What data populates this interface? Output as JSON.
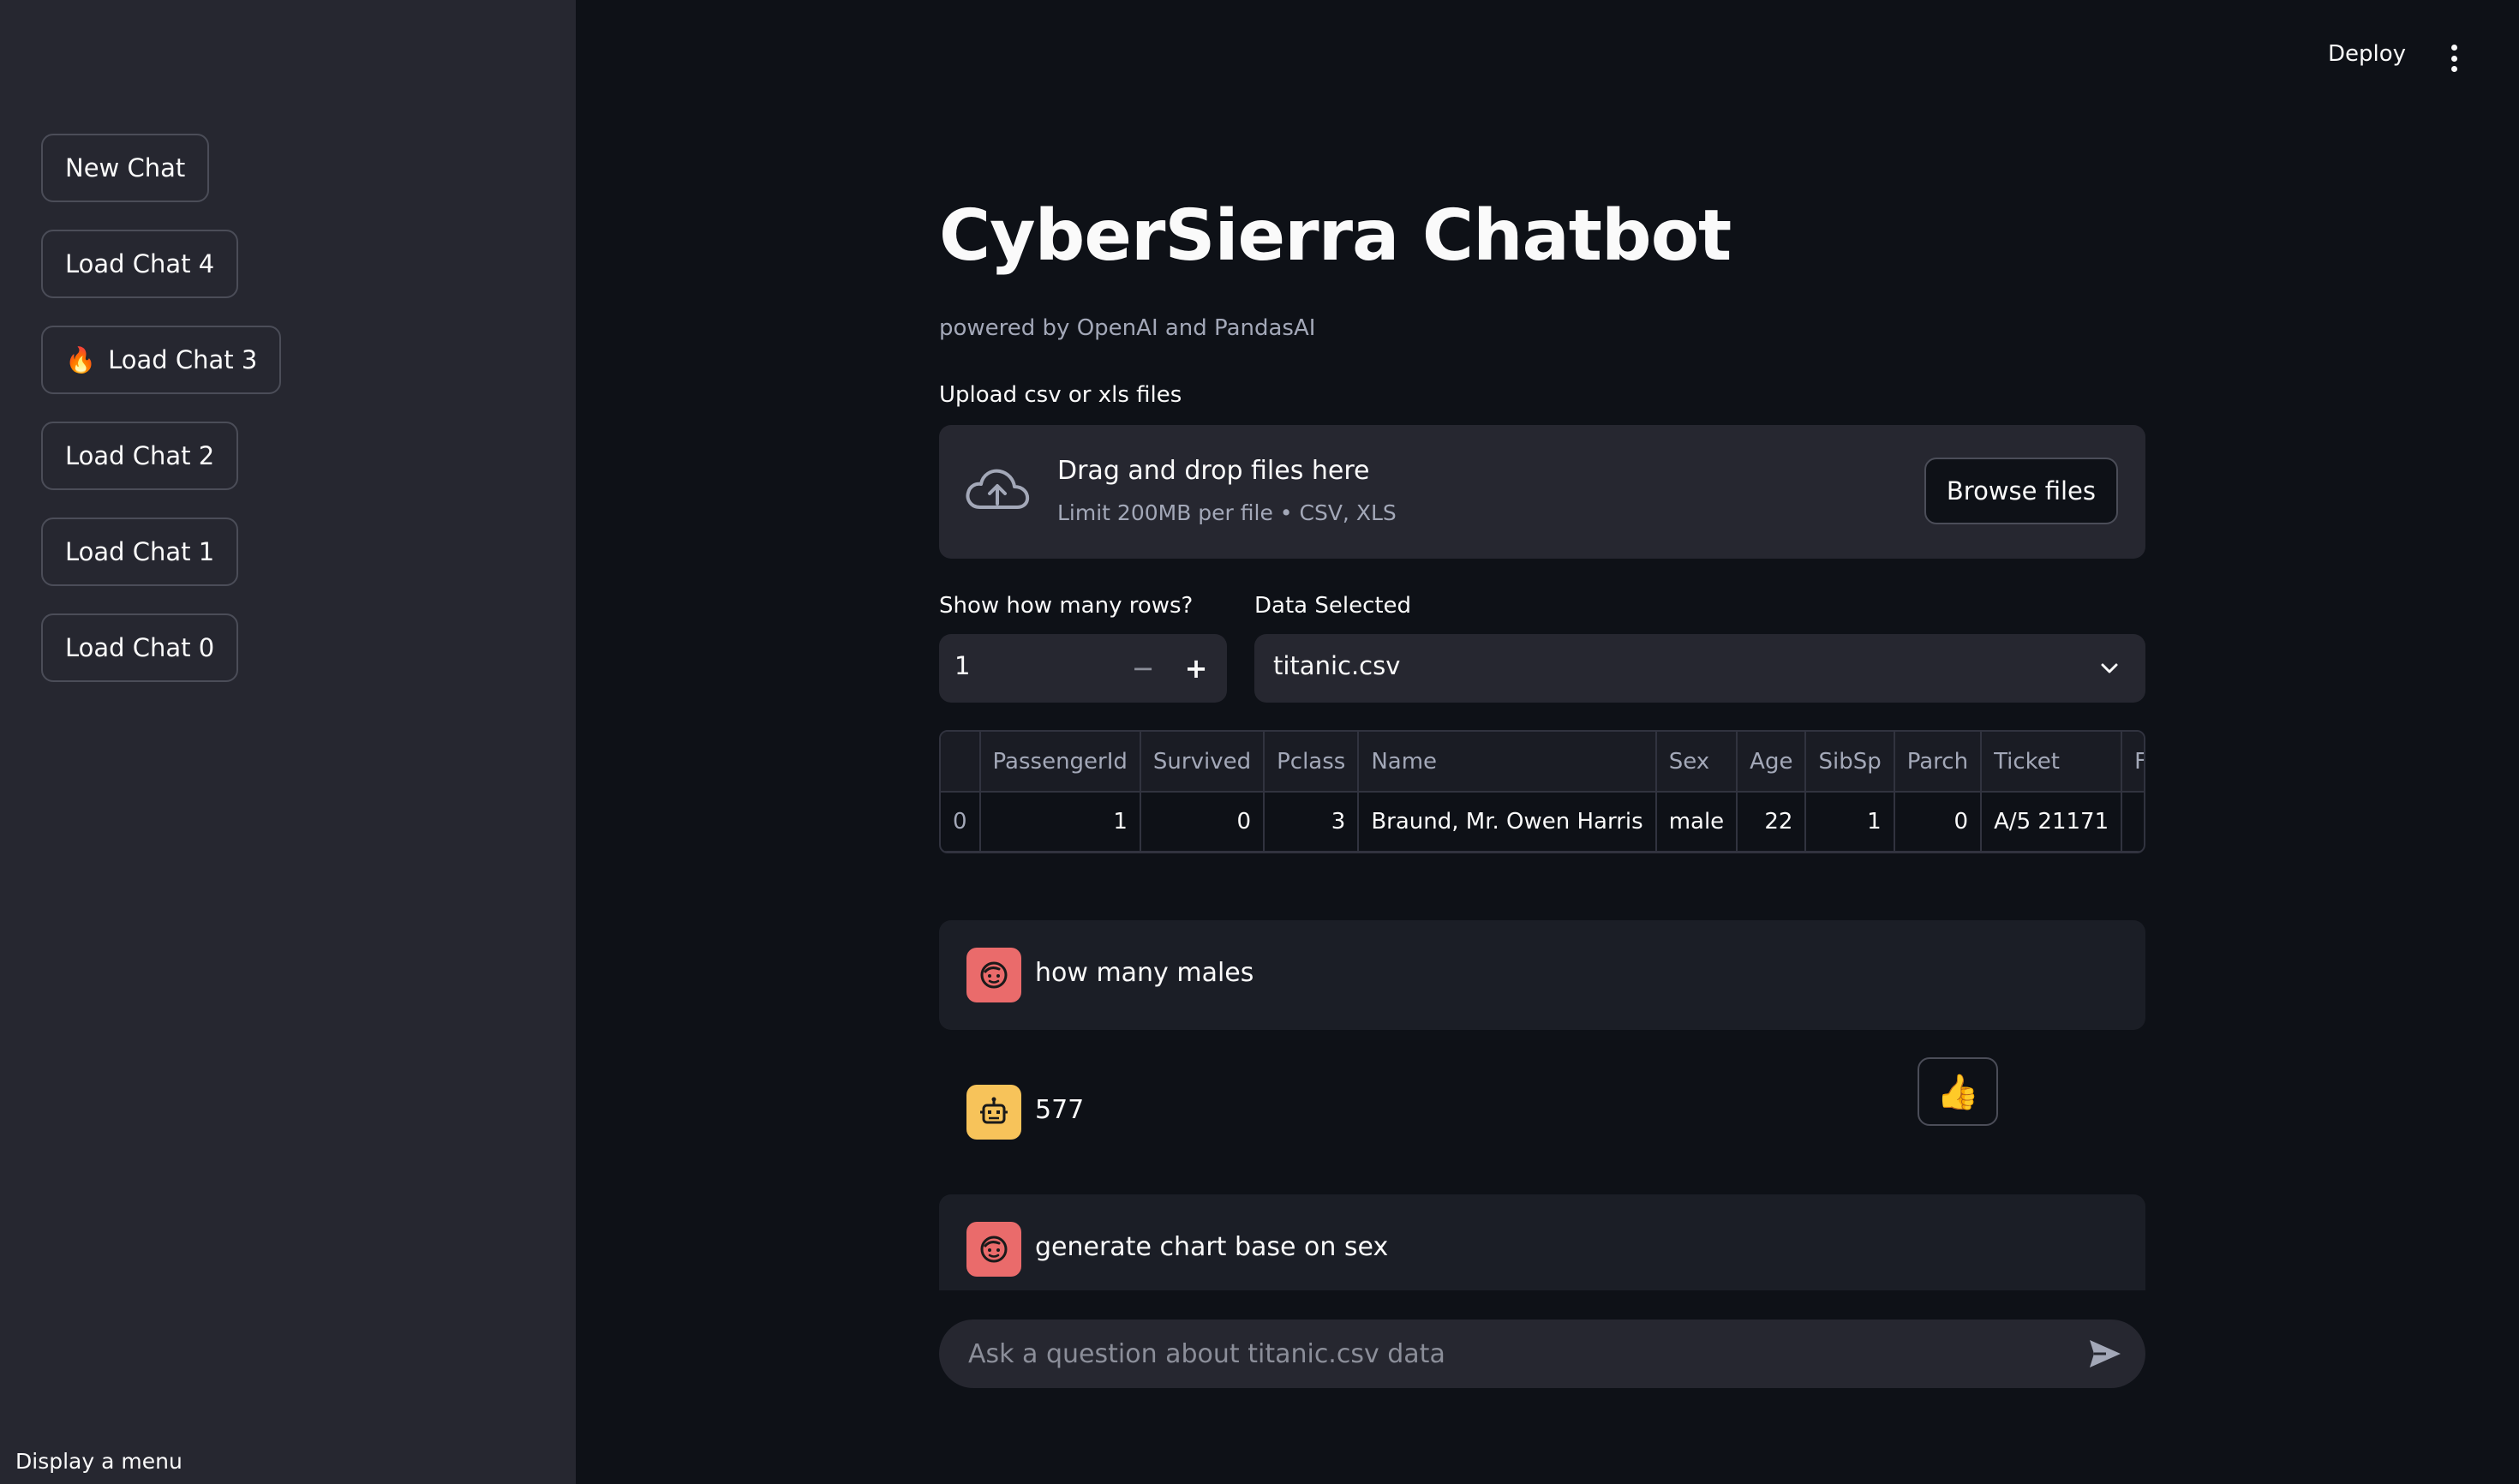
{
  "sidebar": {
    "buttons": [
      {
        "label": "New Chat",
        "emoji": ""
      },
      {
        "label": "Load Chat 4",
        "emoji": ""
      },
      {
        "label": "Load Chat 3",
        "emoji": "🔥"
      },
      {
        "label": "Load Chat 2",
        "emoji": ""
      },
      {
        "label": "Load Chat 1",
        "emoji": ""
      },
      {
        "label": "Load Chat 0",
        "emoji": ""
      }
    ],
    "footer": "Display a menu"
  },
  "header": {
    "deploy_label": "Deploy"
  },
  "main": {
    "title": "CyberSierra Chatbot",
    "subtitle": "powered by OpenAI and PandasAI",
    "upload": {
      "label": "Upload csv or xls files",
      "drag_text": "Drag and drop files here",
      "limit_text": "Limit 200MB per file • CSV, XLS",
      "browse_label": "Browse files"
    },
    "rows_input": {
      "label": "Show how many rows?",
      "value": "1",
      "minus": "−",
      "plus": "+"
    },
    "data_select": {
      "label": "Data Selected",
      "value": "titanic.csv"
    },
    "table": {
      "columns": [
        "",
        "PassengerId",
        "Survived",
        "Pclass",
        "Name",
        "Sex",
        "Age",
        "SibSp",
        "Parch",
        "Ticket",
        "F"
      ],
      "rows": [
        [
          "0",
          "1",
          "0",
          "3",
          "Braund, Mr. Owen Harris",
          "male",
          "22",
          "1",
          "0",
          "A/5 21171",
          ""
        ]
      ]
    },
    "chat": {
      "messages": [
        {
          "role": "user",
          "text": "how many males"
        },
        {
          "role": "assistant",
          "text": "577"
        },
        {
          "role": "user",
          "text": "generate chart base on sex"
        }
      ],
      "feedback_emoji": "👍",
      "input_placeholder": "Ask a question about titanic.csv data"
    }
  },
  "colors": {
    "background": "#0e1117",
    "sidebar": "#262730",
    "user_avatar": "#ea6b6b",
    "bot_avatar": "#f7c35a"
  }
}
